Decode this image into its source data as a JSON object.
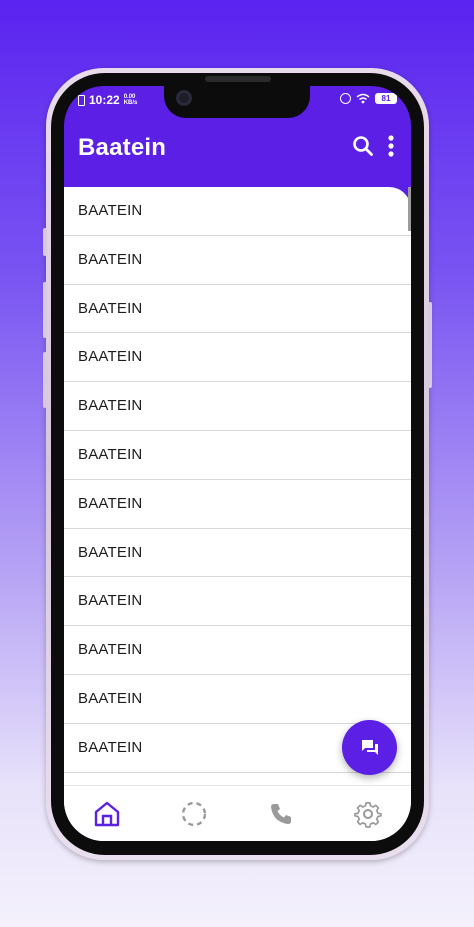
{
  "status_bar": {
    "time": "10:22",
    "net_speed_value": "0.00",
    "net_speed_unit": "KB/s",
    "battery": "81"
  },
  "app": {
    "title": "Baatein",
    "accent_color": "#5b1fe6"
  },
  "toolbar": {
    "search_icon": "search-icon",
    "more_icon": "more-vert-icon"
  },
  "chats": [
    {
      "label": "BAATEIN"
    },
    {
      "label": "BAATEIN"
    },
    {
      "label": "BAATEIN"
    },
    {
      "label": "BAATEIN"
    },
    {
      "label": "BAATEIN"
    },
    {
      "label": "BAATEIN"
    },
    {
      "label": "BAATEIN"
    },
    {
      "label": "BAATEIN"
    },
    {
      "label": "BAATEIN"
    },
    {
      "label": "BAATEIN"
    },
    {
      "label": "BAATEIN"
    },
    {
      "label": "BAATEIN"
    }
  ],
  "fab": {
    "icon": "new-chat-icon"
  },
  "bottom_nav": [
    {
      "icon": "home-icon",
      "active": true
    },
    {
      "icon": "status-icon",
      "active": false
    },
    {
      "icon": "phone-icon",
      "active": false
    },
    {
      "icon": "settings-icon",
      "active": false
    }
  ]
}
